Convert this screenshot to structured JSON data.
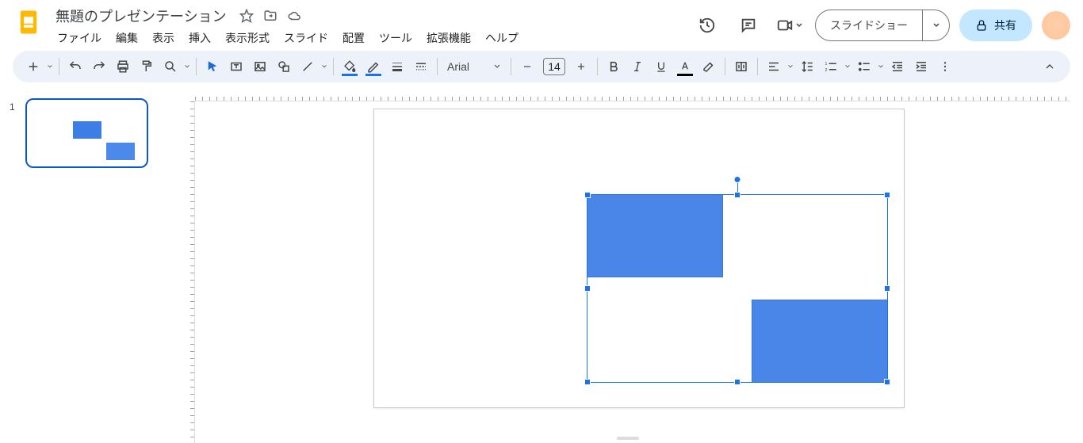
{
  "header": {
    "title": "無題のプレゼンテーション",
    "menus": [
      "ファイル",
      "編集",
      "表示",
      "挿入",
      "表示形式",
      "スライド",
      "配置",
      "ツール",
      "拡張機能",
      "ヘルプ"
    ],
    "slideshow_label": "スライドショー",
    "share_label": "共有"
  },
  "toolbar": {
    "font_name": "Arial",
    "font_size": "14"
  },
  "filmstrip": {
    "slides": [
      {
        "number": "1"
      }
    ]
  }
}
